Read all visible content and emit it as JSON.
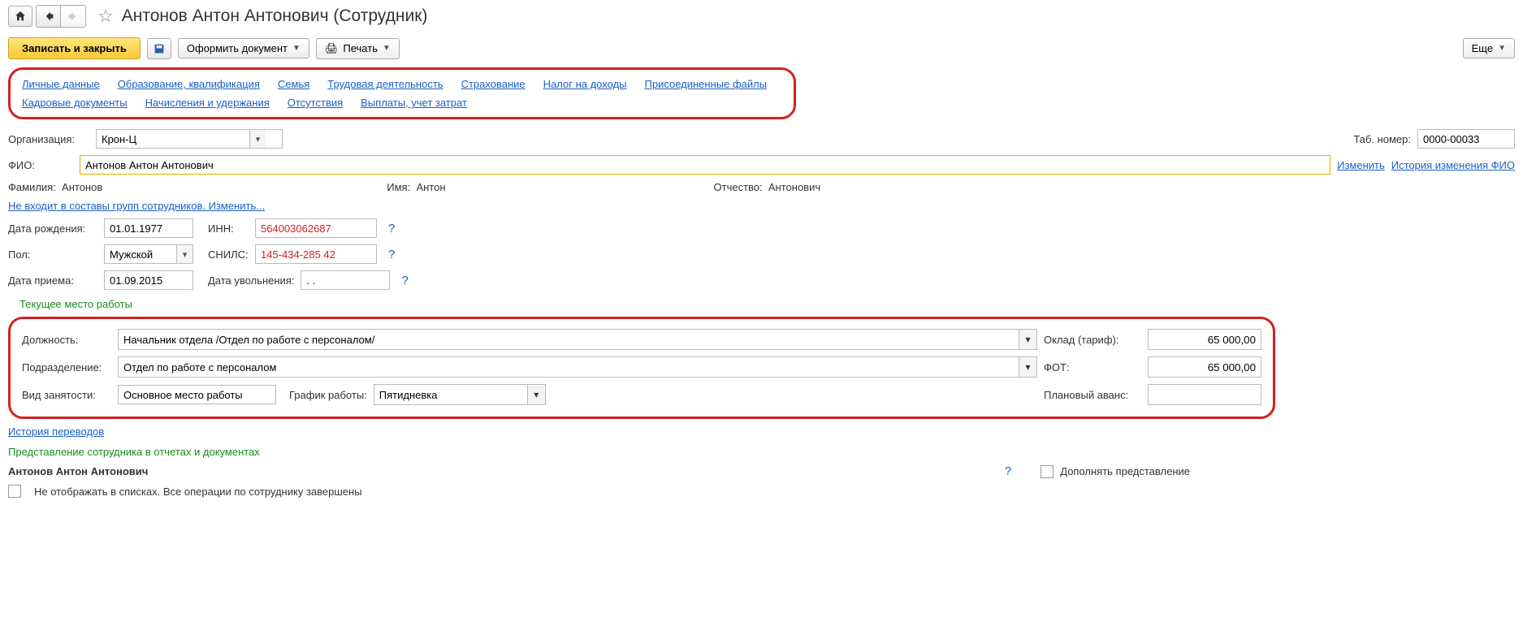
{
  "header": {
    "title": "Антонов Антон Антонович (Сотрудник)",
    "save_close": "Записать и закрыть",
    "doc_btn": "Оформить документ",
    "print_btn": "Печать",
    "more_btn": "Еще"
  },
  "links": {
    "r1": [
      "Личные данные",
      "Образование, квалификация",
      "Семья",
      "Трудовая деятельность",
      "Страхование",
      "Налог на доходы",
      "Присоединенные файлы"
    ],
    "r2": [
      "Кадровые документы",
      "Начисления и удержания",
      "Отсутствия",
      "Выплаты, учет затрат"
    ]
  },
  "org": {
    "label": "Организация:",
    "value": "Крон-Ц",
    "tab_label": "Таб. номер:",
    "tab_value": "0000-00033"
  },
  "fio_row": {
    "label": "ФИО:",
    "value": "Антонов Антон Антонович",
    "change": "Изменить",
    "history": "История изменения ФИО"
  },
  "name": {
    "fam_l": "Фамилия:",
    "fam": "Антонов",
    "name_l": "Имя:",
    "name": "Антон",
    "mid_l": "Отчество:",
    "mid": "Антонович"
  },
  "groups_link": "Не входит в составы групп сотрудников. Изменить...",
  "birth": {
    "label": "Дата рождения:",
    "value": "01.01.1977",
    "inn_l": "ИНН:",
    "inn": "564003062687"
  },
  "gender": {
    "label": "Пол:",
    "value": "Мужской",
    "snils_l": "СНИЛС:",
    "snils": "145-434-285 42"
  },
  "hire": {
    "label": "Дата приема:",
    "value": "01.09.2015",
    "fire_l": "Дата увольнения:",
    "fire": ". ."
  },
  "job": {
    "section": "Текущее место работы",
    "pos_l": "Должность:",
    "pos": "Начальник отдела /Отдел по работе с персоналом/",
    "dep_l": "Подразделение:",
    "dep": "Отдел по работе с персоналом",
    "type_l": "Вид занятости:",
    "type": "Основное место работы",
    "sched_l": "График работы:",
    "sched": "Пятидневка",
    "salary_l": "Оклад (тариф):",
    "salary": "65 000,00",
    "fot_l": "ФОТ:",
    "fot": "65 000,00",
    "advance_l": "Плановый аванс:",
    "advance": ""
  },
  "history_link": "История переводов",
  "repr": {
    "section": "Представление сотрудника в отчетах и документах",
    "name": "Антонов Антон Антонович",
    "supplement": "Дополнять представление",
    "hide_lists": "Не отображать в списках. Все операции по сотруднику завершены"
  }
}
